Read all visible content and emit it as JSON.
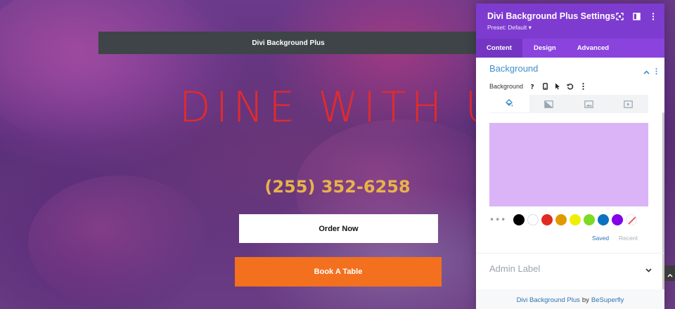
{
  "page": {
    "top_bar_title": "Divi Background Plus",
    "hero_title": "DINE WITH US",
    "phone": "(255) 352-6258",
    "order_button": "Order Now",
    "book_button": "Book A Table"
  },
  "panel": {
    "title": "Divi Background Plus Settings",
    "preset": "Preset: Default ▾",
    "tabs": [
      {
        "label": "Content",
        "active": true
      },
      {
        "label": "Design",
        "active": false
      },
      {
        "label": "Advanced",
        "active": false
      }
    ],
    "section_title": "Background",
    "field_label": "Background",
    "preview_color": "#dab4f7",
    "swatches": [
      "#000000",
      "#ffffff",
      "#e02b20",
      "#e09900",
      "#edf000",
      "#7cda24",
      "#0c71c3",
      "#8300e9"
    ],
    "saved_label": "Saved",
    "recent_label": "Recent",
    "admin_label": "Admin Label",
    "footer": {
      "plugin": "Divi Background Plus",
      "by": "by",
      "author": "BeSuperfly"
    }
  },
  "colors": {
    "panel_header": "#7e3bd0",
    "accent_blue": "#3f8fc9",
    "orange": "#f3701f",
    "hero_red": "#e32b2b",
    "phone_gold": "#e8b24a"
  }
}
